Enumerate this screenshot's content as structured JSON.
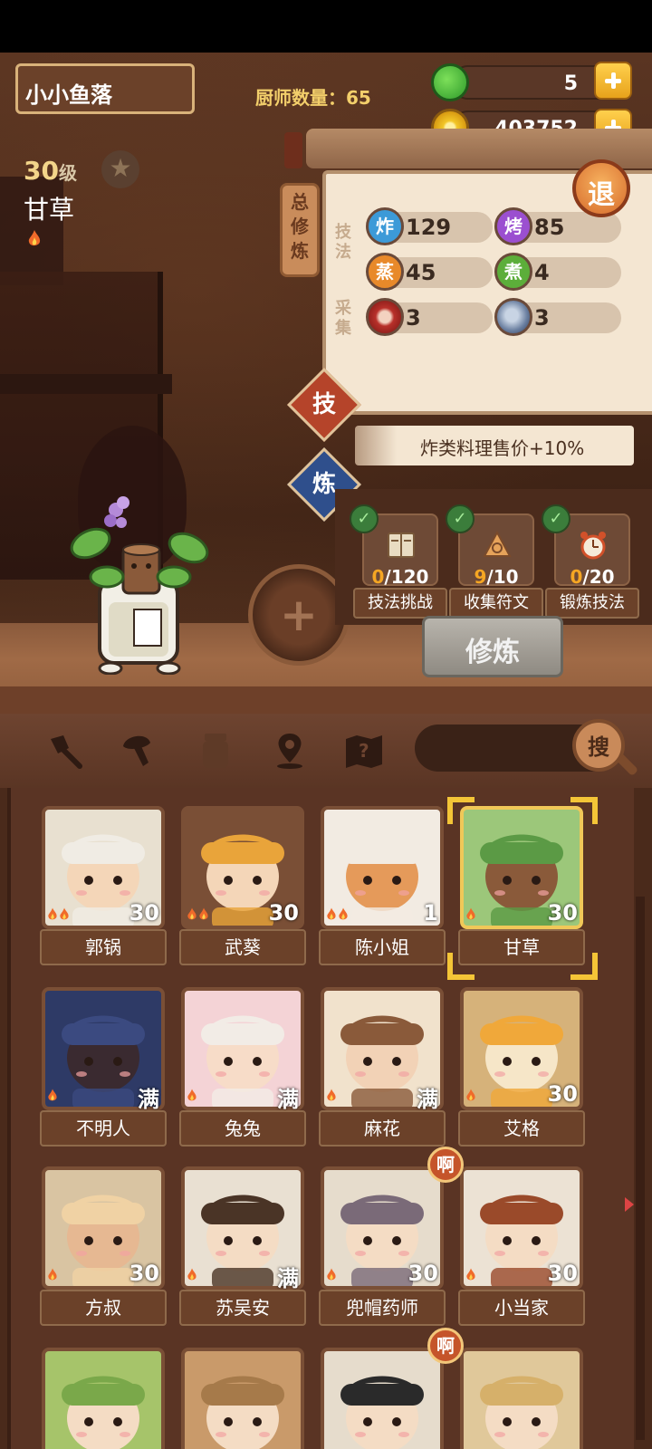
{
  "header": {
    "player_name": "小小鱼落",
    "chef_count_label": "厨师数量：65"
  },
  "resources": {
    "green": {
      "value": "5",
      "icon": "green-apple-icon"
    },
    "coins": {
      "value": "403752",
      "icon": "coin-icon"
    }
  },
  "character": {
    "level": "30",
    "level_unit": "级",
    "name": "甘草"
  },
  "panel": {
    "side_tab": [
      "总",
      "修",
      "炼"
    ],
    "label_skills": [
      "技",
      "法"
    ],
    "label_gather": [
      "采",
      "集"
    ],
    "skills": [
      {
        "glyph": "炸",
        "value": "129",
        "color": "#3c9ad8"
      },
      {
        "glyph": "烤",
        "value": "85",
        "color": "#9b4fd0"
      },
      {
        "glyph": "蒸",
        "value": "45",
        "color": "#e8892a"
      },
      {
        "glyph": "煮",
        "value": "4",
        "color": "#5cae3a"
      }
    ],
    "gather": [
      {
        "icon": "meat-icon",
        "value": "3"
      },
      {
        "icon": "fish-icon",
        "value": "3"
      }
    ],
    "exit_label": "退",
    "tab_skill": "技",
    "tab_refine": "炼",
    "bonus_text": "炸类料理售价+10%"
  },
  "tasks": [
    {
      "done": "0",
      "total": "/120",
      "label": "技法挑战",
      "icon": "book-icon"
    },
    {
      "done": "9",
      "total": "/10",
      "label": "收集符文",
      "icon": "rune-icon"
    },
    {
      "done": "0",
      "total": "/20",
      "label": "锻炼技法",
      "icon": "alarm-clock-icon"
    }
  ],
  "cultivate_button": "修炼",
  "add_symbol": "+",
  "search_button": "搜",
  "filters": [
    "shovel-icon",
    "mushroom-icon",
    "jar-icon",
    "map-pin-icon",
    "treasure-map-icon"
  ],
  "cards": [
    {
      "name": "郭锅",
      "level": "30",
      "flames": 2,
      "bg": "#e8e0d0",
      "face": "#f4d6b8",
      "hat": "#f0ece4"
    },
    {
      "name": "武葵",
      "level": "30",
      "flames": 2,
      "bg": "#7a4f36",
      "face": "#f4d6b8",
      "hat": "#e9a43a"
    },
    {
      "name": "陈小姐",
      "level": "1",
      "flames": 2,
      "bg": "#f2ebe2",
      "face": "#e59a5a",
      "hat": "#f2ebe2"
    },
    {
      "name": "甘草",
      "level": "30",
      "flames": 1,
      "bg": "#9cc77a",
      "face": "#8a5a3a",
      "hat": "#5b9a45"
    },
    {
      "name": "不明人",
      "level": "满",
      "flames": 1,
      "bg": "#2e3a66",
      "face": "#3a2a30",
      "hat": "#3b4a80"
    },
    {
      "name": "兔兔",
      "level": "满",
      "flames": 1,
      "bg": "#f4d3d6",
      "face": "#f7dcc8",
      "hat": "#f2ece6"
    },
    {
      "name": "麻花",
      "level": "满",
      "flames": 1,
      "bg": "#f1e2cc",
      "face": "#f2d2b6",
      "hat": "#8a5a3a"
    },
    {
      "name": "艾格",
      "level": "30",
      "flames": 1,
      "bg": "#d6b27a",
      "face": "#f6e6c8",
      "hat": "#f0a83a"
    },
    {
      "name": "方叔",
      "level": "30",
      "flames": 1,
      "bg": "#d9c4a2",
      "face": "#e6b892",
      "hat": "#f0d2a4"
    },
    {
      "name": "苏吴安",
      "level": "满",
      "flames": 1,
      "bg": "#e9e0d2",
      "face": "#f4dcc4",
      "hat": "#4a3426"
    },
    {
      "name": "兜帽药师",
      "level": "30",
      "flames": 1,
      "bg": "#e6dccc",
      "face": "#f4dcc4",
      "hat": "#7a6a78"
    },
    {
      "name": "小当家",
      "level": "30",
      "flames": 1,
      "bg": "#ece2d4",
      "face": "#f4dcc4",
      "hat": "#9a4a2a"
    },
    {
      "name": "",
      "level": "",
      "flames": 0,
      "bg": "#a6c46a",
      "face": "#f4dcc4",
      "hat": "#7aa84a"
    },
    {
      "name": "",
      "level": "",
      "flames": 0,
      "bg": "#c99a6a",
      "face": "#f4dcc4",
      "hat": "#a67a4a"
    },
    {
      "name": "",
      "level": "",
      "flames": 0,
      "bg": "#e6dccc",
      "face": "#f4dcc4",
      "hat": "#2a2a2a"
    },
    {
      "name": "",
      "level": "",
      "flames": 0,
      "bg": "#e0c89a",
      "face": "#f4dcc4",
      "hat": "#d6b06a"
    }
  ],
  "badges": [
    "啊",
    "啊"
  ],
  "selected_card": "甘草"
}
